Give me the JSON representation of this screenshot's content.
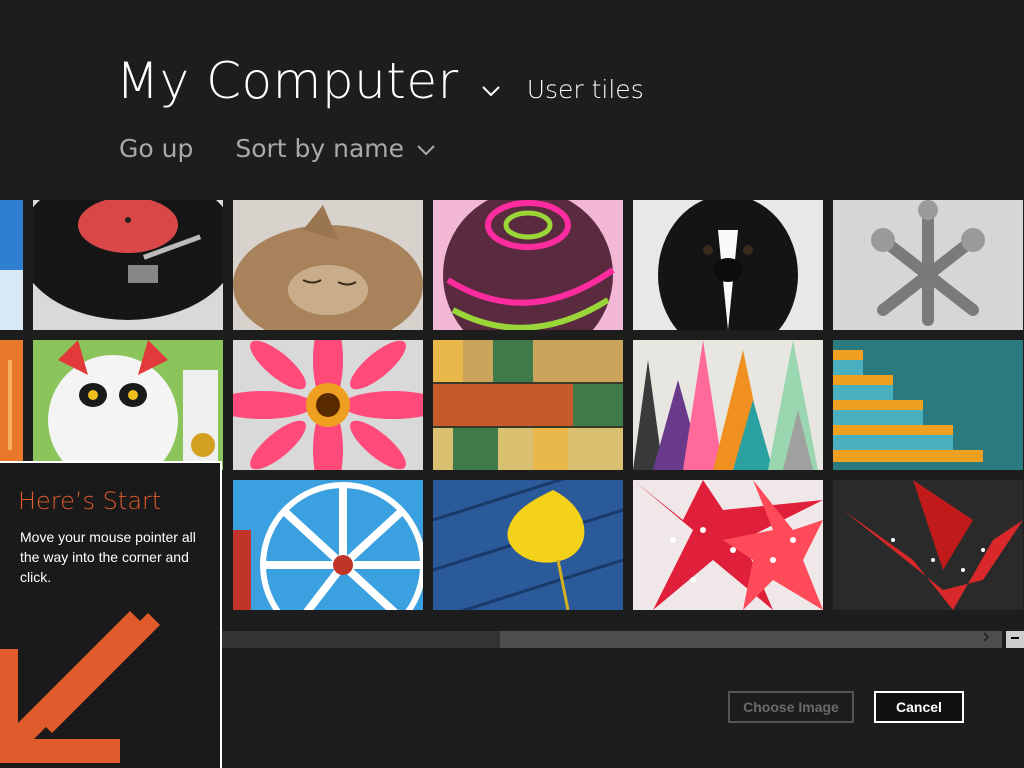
{
  "header": {
    "title": "My Computer",
    "subtitle": "User tiles"
  },
  "nav": {
    "go_up": "Go up",
    "sort": "Sort by name"
  },
  "tiles": [
    {
      "name": "turntable"
    },
    {
      "name": "kitten"
    },
    {
      "name": "striped-ball"
    },
    {
      "name": "dog"
    },
    {
      "name": "jacks"
    },
    {
      "name": "lucky-cat"
    },
    {
      "name": "pink-flower"
    },
    {
      "name": "yarn"
    },
    {
      "name": "crayons"
    },
    {
      "name": "stairs"
    },
    {
      "name": "ferris-wheel"
    },
    {
      "name": "yellow-leaf"
    },
    {
      "name": "paper-stars"
    },
    {
      "name": "paper-crane"
    }
  ],
  "buttons": {
    "choose": "Choose Image",
    "cancel": "Cancel"
  },
  "start_tip": {
    "title": "Here’s Start",
    "body": "Move your mouse pointer all the way into the corner and click."
  },
  "colors": {
    "background": "#1d1d1d",
    "accent": "#e05a2b"
  }
}
